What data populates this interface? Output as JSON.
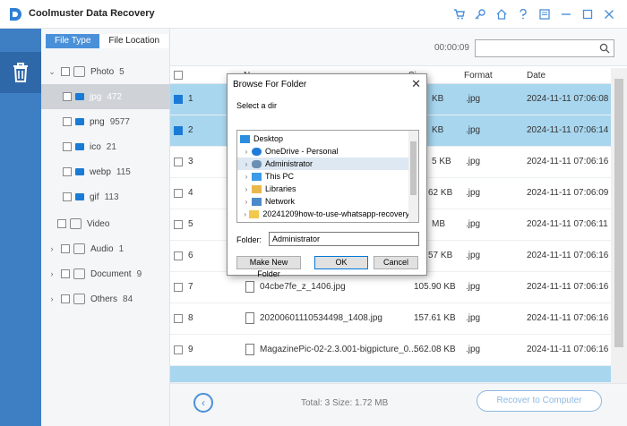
{
  "app": {
    "title": "Coolmuster Data Recovery",
    "accent": "#3e7fc4",
    "titlebar_icons": [
      "cart-icon",
      "key-icon",
      "home-icon",
      "help-icon",
      "feedback-icon",
      "minimize-icon",
      "maximize-icon",
      "close-icon"
    ]
  },
  "tree": {
    "tabs": [
      {
        "label": "File Type",
        "active": true
      },
      {
        "label": "File Location",
        "active": false
      }
    ],
    "items": [
      {
        "label": "Photo",
        "count": "5",
        "level": 0,
        "expanded": true,
        "icon": "image-icon"
      },
      {
        "label": "jpg",
        "count": "472",
        "level": 1,
        "selected": true,
        "icon": "folder-icon"
      },
      {
        "label": "png",
        "count": "9577",
        "level": 1,
        "icon": "folder-icon"
      },
      {
        "label": "ico",
        "count": "21",
        "level": 1,
        "icon": "folder-icon"
      },
      {
        "label": "webp",
        "count": "115",
        "level": 1,
        "icon": "folder-icon"
      },
      {
        "label": "gif",
        "count": "113",
        "level": 1,
        "icon": "folder-icon"
      },
      {
        "label": "Video",
        "count": "",
        "level": 0,
        "icon": "video-icon"
      },
      {
        "label": "Audio",
        "count": "1",
        "level": 0,
        "icon": "music-icon"
      },
      {
        "label": "Document",
        "count": "9",
        "level": 0,
        "icon": "document-icon"
      },
      {
        "label": "Others",
        "count": "84",
        "level": 0,
        "icon": "others-icon"
      }
    ]
  },
  "toolbar": {
    "timer": "00:00:09",
    "search_placeholder": ""
  },
  "table": {
    "headers": {
      "name": "N",
      "size": "Si",
      "format": "Format",
      "date": "Date"
    },
    "rows": [
      {
        "num": "1",
        "name": "",
        "size": "KB",
        "format": ".jpg",
        "date": "2024-11-11 07:06:08",
        "selected": true
      },
      {
        "num": "2",
        "name": "",
        "size": "KB",
        "format": ".jpg",
        "date": "2024-11-11 07:06:14",
        "selected": true
      },
      {
        "num": "3",
        "name": "",
        "size": "5 KB",
        "format": ".jpg",
        "date": "2024-11-11 07:06:16"
      },
      {
        "num": "4",
        "name": "",
        "size": "62 KB",
        "format": ".jpg",
        "date": "2024-11-11 07:06:09"
      },
      {
        "num": "5",
        "name": "",
        "size": "MB",
        "format": ".jpg",
        "date": "2024-11-11 07:06:11"
      },
      {
        "num": "6",
        "name": "",
        "size": "57 KB",
        "format": ".jpg",
        "date": "2024-11-11 07:06:16"
      },
      {
        "num": "7",
        "name": "04cbe7fe_z_1406.jpg",
        "size": "105.90 KB",
        "format": ".jpg",
        "date": "2024-11-11 07:06:16"
      },
      {
        "num": "8",
        "name": "20200601110534498_1408.jpg",
        "size": "157.61 KB",
        "format": ".jpg",
        "date": "2024-11-11 07:06:16"
      },
      {
        "num": "9",
        "name": "MagazinePic-02-2.3.001-bigpicture_0...",
        "size": "562.08 KB",
        "format": ".jpg",
        "date": "2024-11-11 07:06:16"
      }
    ]
  },
  "footer": {
    "totals": "Total: 3   Size: 1.72 MB",
    "recover_label": "Recover to Computer"
  },
  "dialog": {
    "title": "Browse For Folder",
    "subtitle": "Select a dir",
    "items": [
      {
        "label": "Desktop",
        "level": 0,
        "icon": "desktop-icon"
      },
      {
        "label": "OneDrive - Personal",
        "level": 1,
        "icon": "cloud-icon"
      },
      {
        "label": "Administrator",
        "level": 1,
        "icon": "user-icon",
        "selected": true
      },
      {
        "label": "This PC",
        "level": 1,
        "icon": "computer-icon"
      },
      {
        "label": "Libraries",
        "level": 1,
        "icon": "library-icon"
      },
      {
        "label": "Network",
        "level": 1,
        "icon": "network-icon"
      },
      {
        "label": "20241209how-to-use-whatsapp-recovery",
        "level": 1,
        "icon": "folder-icon"
      }
    ],
    "folder_label": "Folder:",
    "folder_value": "Administrator",
    "new_folder_label": "Make New Folder",
    "ok_label": "OK",
    "cancel_label": "Cancel"
  }
}
